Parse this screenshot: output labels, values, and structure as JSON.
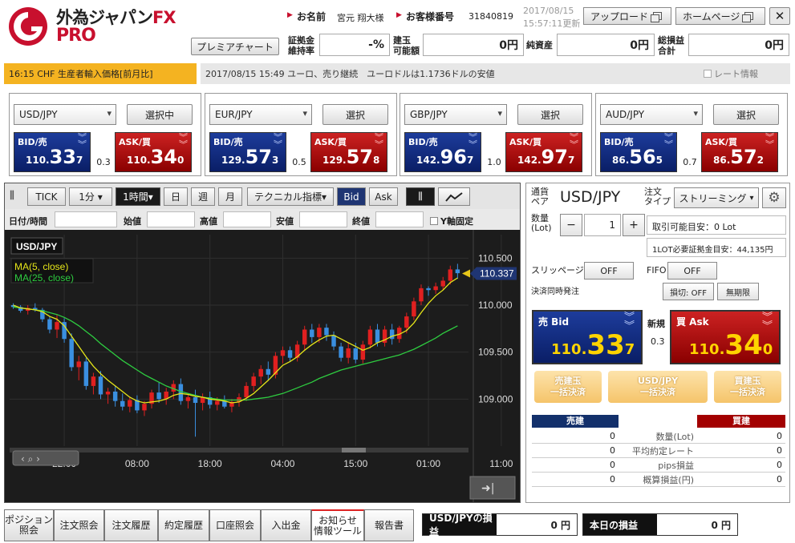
{
  "header": {
    "logo_main": "外為ジャパン",
    "logo_fx": "FX",
    "logo_pro": "PRO",
    "name_label": "お名前",
    "name_value": "宮元 翔大様",
    "customer_label": "お客様番号",
    "customer_value": "31840819",
    "update_date": "2017/08/15",
    "update_time": "15:57:11更新",
    "upload_label": "アップロード",
    "homepage_label": "ホームページ",
    "close_label": "✕",
    "premier_chart_label": "プレミアチャート",
    "margin_ratio_label_1": "証拠金",
    "margin_ratio_label_2": "維持率",
    "margin_ratio_value": "-%",
    "available_label_1": "建玉",
    "available_label_2": "可能額",
    "available_value": "0円",
    "net_assets_label": "純資産",
    "net_assets_value": "0円",
    "total_pl_label_1": "総損益",
    "total_pl_label_2": "合計",
    "total_pl_value": "0円"
  },
  "news": {
    "left": "16:15 CHF 生産者輸入価格[前月比]",
    "right": "2017/08/15 15:49 ユーロ、売り継続　ユーロドルは1.1736ドルの安値",
    "rate_info_label": "レート情報"
  },
  "currency_panels": [
    {
      "pair": "USD/JPY",
      "button": "選択中",
      "bid_label": "BID/売",
      "ask_label": "ASK/買",
      "bid_pre": "110.",
      "bid_big": "33",
      "bid_small": "7",
      "ask_pre": "110.",
      "ask_big": "34",
      "ask_small": "0",
      "spread": "0.3"
    },
    {
      "pair": "EUR/JPY",
      "button": "選択",
      "bid_label": "BID/売",
      "ask_label": "ASK/買",
      "bid_pre": "129.",
      "bid_big": "57",
      "bid_small": "3",
      "ask_pre": "129.",
      "ask_big": "57",
      "ask_small": "8",
      "spread": "0.5"
    },
    {
      "pair": "GBP/JPY",
      "button": "選択",
      "bid_label": "BID/売",
      "ask_label": "ASK/買",
      "bid_pre": "142.",
      "bid_big": "96",
      "bid_small": "7",
      "ask_pre": "142.",
      "ask_big": "97",
      "ask_small": "7",
      "spread": "1.0"
    },
    {
      "pair": "AUD/JPY",
      "button": "選択",
      "bid_label": "BID/売",
      "ask_label": "ASK/買",
      "bid_pre": "86.",
      "bid_big": "56",
      "bid_small": "5",
      "ask_pre": "86.",
      "ask_big": "57",
      "ask_small": "2",
      "spread": "0.7"
    }
  ],
  "chart_toolbar": {
    "tick": "TICK",
    "minute": "1分 ▾",
    "hour": "1時間▾",
    "day": "日",
    "week": "週",
    "month": "月",
    "technical": "テクニカル指標▾",
    "bid": "Bid",
    "ask": "Ask"
  },
  "ohlc": {
    "datetime": "日付/時間",
    "open": "始値",
    "high": "高値",
    "low": "安値",
    "close": "終値",
    "y_fixed": "Y軸固定"
  },
  "chart_data": {
    "type": "candlestick",
    "symbol": "USD/JPY",
    "legend": [
      "MA(5, close)",
      "MA(25, close)"
    ],
    "legend_colors": [
      "#e6e619",
      "#2ecc40"
    ],
    "up_color": "#e02020",
    "down_color": "#3a8fe0",
    "y_ticks": [
      "110.500",
      "110.000",
      "109.500",
      "109.000"
    ],
    "y_tick_values": [
      110.5,
      110.0,
      109.5,
      109.0
    ],
    "ylim": [
      108.5,
      110.75
    ],
    "x_ticks": [
      "22:00",
      "08:00",
      "18:00",
      "04:00",
      "15:00",
      "01:00",
      "11:00"
    ],
    "x_tick_index": [
      7,
      17,
      27,
      37,
      47,
      57,
      67
    ],
    "current_price": "110.337",
    "current_value": 110.337,
    "candles": [
      [
        110.0,
        110.02,
        109.96,
        109.98
      ],
      [
        109.98,
        110.0,
        109.92,
        109.94
      ],
      [
        109.94,
        110.0,
        109.9,
        109.97
      ],
      [
        109.97,
        110.02,
        109.93,
        109.95
      ],
      [
        109.95,
        109.97,
        109.82,
        109.85
      ],
      [
        109.85,
        109.88,
        109.7,
        109.74
      ],
      [
        109.74,
        109.9,
        109.65,
        109.82
      ],
      [
        109.82,
        109.86,
        109.6,
        109.64
      ],
      [
        109.64,
        109.7,
        109.3,
        109.34
      ],
      [
        109.34,
        109.46,
        109.2,
        109.4
      ],
      [
        109.4,
        109.44,
        109.1,
        109.14
      ],
      [
        109.14,
        109.28,
        109.05,
        109.24
      ],
      [
        109.24,
        109.3,
        109.0,
        109.05
      ],
      [
        109.05,
        109.12,
        108.95,
        109.08
      ],
      [
        109.08,
        109.14,
        108.92,
        108.98
      ],
      [
        108.98,
        109.06,
        108.88,
        108.92
      ],
      [
        108.92,
        109.02,
        108.86,
        108.99
      ],
      [
        108.99,
        109.04,
        108.85,
        108.88
      ],
      [
        108.88,
        108.98,
        108.82,
        108.95
      ],
      [
        108.95,
        109.1,
        108.9,
        109.07
      ],
      [
        109.07,
        109.18,
        108.96,
        109.0
      ],
      [
        109.0,
        109.12,
        108.94,
        109.08
      ],
      [
        109.08,
        109.2,
        109.0,
        109.16
      ],
      [
        109.16,
        109.22,
        108.94,
        108.98
      ],
      [
        108.98,
        109.05,
        108.9,
        109.02
      ],
      [
        109.02,
        109.1,
        108.6,
        108.96
      ],
      [
        108.96,
        109.06,
        108.88,
        109.02
      ],
      [
        109.02,
        109.08,
        108.9,
        108.94
      ],
      [
        108.94,
        109.02,
        108.88,
        108.98
      ],
      [
        108.98,
        109.04,
        108.9,
        108.92
      ],
      [
        108.92,
        109.0,
        108.86,
        108.97
      ],
      [
        108.97,
        109.06,
        108.92,
        109.02
      ],
      [
        109.02,
        109.18,
        108.98,
        109.14
      ],
      [
        109.14,
        109.28,
        109.08,
        109.24
      ],
      [
        109.24,
        109.36,
        109.16,
        109.32
      ],
      [
        109.32,
        109.4,
        109.2,
        109.26
      ],
      [
        109.26,
        109.5,
        109.22,
        109.46
      ],
      [
        109.46,
        109.56,
        109.38,
        109.52
      ],
      [
        109.52,
        109.56,
        109.4,
        109.44
      ],
      [
        109.44,
        109.62,
        109.4,
        109.58
      ],
      [
        109.58,
        109.78,
        109.52,
        109.74
      ],
      [
        109.74,
        109.8,
        109.6,
        109.66
      ],
      [
        109.66,
        109.8,
        109.6,
        109.76
      ],
      [
        109.76,
        109.8,
        109.62,
        109.68
      ],
      [
        109.68,
        109.72,
        109.52,
        109.56
      ],
      [
        109.56,
        109.6,
        109.4,
        109.44
      ],
      [
        109.44,
        109.6,
        109.38,
        109.54
      ],
      [
        109.54,
        109.6,
        109.38,
        109.42
      ],
      [
        109.42,
        109.62,
        109.38,
        109.58
      ],
      [
        109.58,
        109.78,
        109.54,
        109.74
      ],
      [
        109.74,
        109.8,
        109.56,
        109.6
      ],
      [
        109.6,
        109.78,
        109.56,
        109.74
      ],
      [
        109.74,
        109.8,
        109.58,
        109.64
      ],
      [
        109.64,
        109.78,
        109.6,
        109.76
      ],
      [
        109.76,
        109.92,
        109.7,
        109.88
      ],
      [
        109.88,
        110.08,
        109.84,
        110.04
      ],
      [
        110.04,
        110.22,
        110.0,
        110.18
      ],
      [
        110.18,
        110.2,
        110.1,
        110.16
      ],
      [
        110.16,
        110.24,
        110.12,
        110.2
      ],
      [
        110.2,
        110.3,
        110.16,
        110.26
      ],
      [
        110.26,
        110.42,
        110.22,
        110.38
      ],
      [
        110.38,
        110.44,
        110.28,
        110.34
      ]
    ],
    "ma5": [
      110.0,
      109.97,
      109.96,
      109.95,
      109.93,
      109.88,
      109.85,
      109.78,
      109.67,
      109.56,
      109.45,
      109.35,
      109.27,
      109.2,
      109.14,
      109.08,
      109.02,
      108.98,
      108.96,
      108.97,
      108.98,
      109.0,
      109.04,
      109.06,
      109.05,
      109.03,
      109.02,
      109.0,
      108.99,
      108.98,
      108.96,
      108.97,
      109.01,
      109.06,
      109.13,
      109.2,
      109.28,
      109.36,
      109.4,
      109.45,
      109.52,
      109.58,
      109.63,
      109.67,
      109.68,
      109.64,
      109.6,
      109.56,
      109.52,
      109.55,
      109.6,
      109.63,
      109.67,
      109.69,
      109.73,
      109.81,
      109.92,
      110.02,
      110.1,
      110.16,
      110.24,
      110.29
    ],
    "ma25": [
      109.98,
      109.97,
      109.96,
      109.95,
      109.94,
      109.92,
      109.9,
      109.87,
      109.83,
      109.78,
      109.72,
      109.66,
      109.59,
      109.53,
      109.47,
      109.41,
      109.36,
      109.31,
      109.26,
      109.22,
      109.18,
      109.14,
      109.11,
      109.08,
      109.06,
      109.04,
      109.02,
      109.01,
      109.0,
      108.99,
      108.99,
      108.99,
      108.99,
      109.0,
      109.01,
      109.02,
      109.04,
      109.06,
      109.09,
      109.12,
      109.15,
      109.18,
      109.22,
      109.25,
      109.28,
      109.31,
      109.33,
      109.35,
      109.37,
      109.39,
      109.41,
      109.43,
      109.45,
      109.47,
      109.5,
      109.53,
      109.57,
      109.61,
      109.65,
      109.7,
      109.74,
      109.78
    ]
  },
  "order": {
    "pair_label_1": "通貨",
    "pair_label_2": "ペア",
    "pair_value": "USD/JPY",
    "type_label_1": "注文",
    "type_label_2": "タイプ",
    "type_value": "ストリーミング",
    "qty_label_1": "数量",
    "qty_label_2": "(Lot)",
    "qty_minus": "−",
    "qty_value": "1",
    "qty_plus": "+",
    "available_lot": "取引可能目安：0 Lot",
    "required_margin": "1LOT必要証拠金目安：44,135円",
    "slippage_label": "スリッページ",
    "slippage_value": "OFF",
    "fifo_label": "FIFO",
    "fifo_value": "OFF",
    "settle_simul_label": "決済同時発注",
    "stop_loss": "損切: OFF",
    "unlimited": "無期限",
    "sell_label": "売 Bid",
    "sell_pre": "110.",
    "sell_big": "33",
    "sell_small": "7",
    "new_label": "新規",
    "spread": "0.3",
    "buy_label": "買 Ask",
    "buy_pre": "110.",
    "buy_big": "34",
    "buy_small": "0",
    "settle_sell_1": "売建玉",
    "settle_sell_2": "一括決済",
    "settle_pair_1": "USD/JPY",
    "settle_pair_2": "一括決済",
    "settle_buy_1": "買建玉",
    "settle_buy_2": "一括決済",
    "sell_header": "売建",
    "buy_header": "買建",
    "rows": [
      {
        "label": "数量(Lot)",
        "sell": "0",
        "buy": "0"
      },
      {
        "label": "平均約定レート",
        "sell": "0",
        "buy": "0"
      },
      {
        "label": "pips損益",
        "sell": "0",
        "buy": "0"
      },
      {
        "label": "概算損益(円)",
        "sell": "0",
        "buy": "0"
      }
    ]
  },
  "bottom_tabs": [
    {
      "l1": "ポジション",
      "l2": "照会"
    },
    {
      "l1": "注文照会",
      "l2": ""
    },
    {
      "l1": "注文履歴",
      "l2": ""
    },
    {
      "l1": "約定履歴",
      "l2": ""
    },
    {
      "l1": "口座照会",
      "l2": ""
    },
    {
      "l1": "入出金",
      "l2": ""
    },
    {
      "l1": "お知らせ",
      "l2": "情報ツール"
    },
    {
      "l1": "報告書",
      "l2": ""
    }
  ],
  "pl": {
    "pair_pl_label": "USD/JPYの損益",
    "pair_pl_value": "0 円",
    "today_pl_label": "本日の損益",
    "today_pl_value": "0 円"
  },
  "colors": {
    "bid_blue": "#1d3c9b",
    "ask_red": "#c22222",
    "news_orange": "#f4b321"
  }
}
